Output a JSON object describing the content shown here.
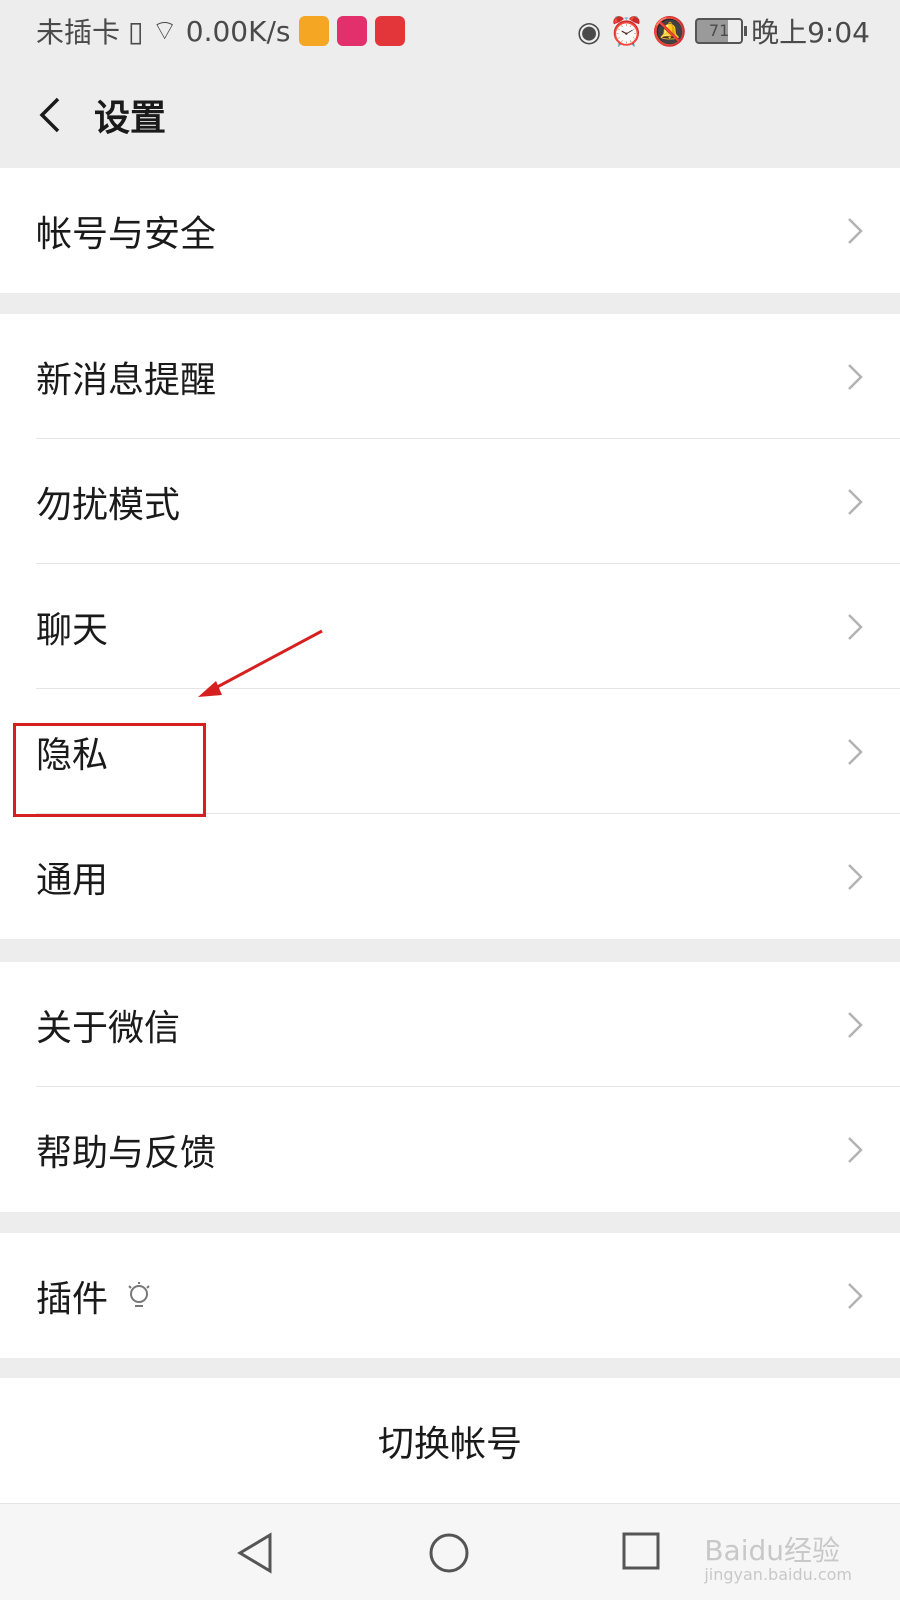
{
  "status_bar": {
    "left_text": "未插卡",
    "speed": "0.00K/s",
    "battery": "71",
    "time": "晚上9:04"
  },
  "header": {
    "title": "设置"
  },
  "sections": [
    {
      "items": [
        "帐号与安全"
      ]
    },
    {
      "items": [
        "新消息提醒",
        "勿扰模式",
        "聊天",
        "隐私",
        "通用"
      ]
    },
    {
      "items": [
        "关于微信",
        "帮助与反馈"
      ]
    },
    {
      "items": [
        "插件"
      ]
    }
  ],
  "switch_account": "切换帐号",
  "watermark": {
    "main": "Baidu经验",
    "sub": "jingyan.baidu.com"
  },
  "colors": {
    "annotation": "#d62020",
    "chevron": "#b3b3b3"
  }
}
